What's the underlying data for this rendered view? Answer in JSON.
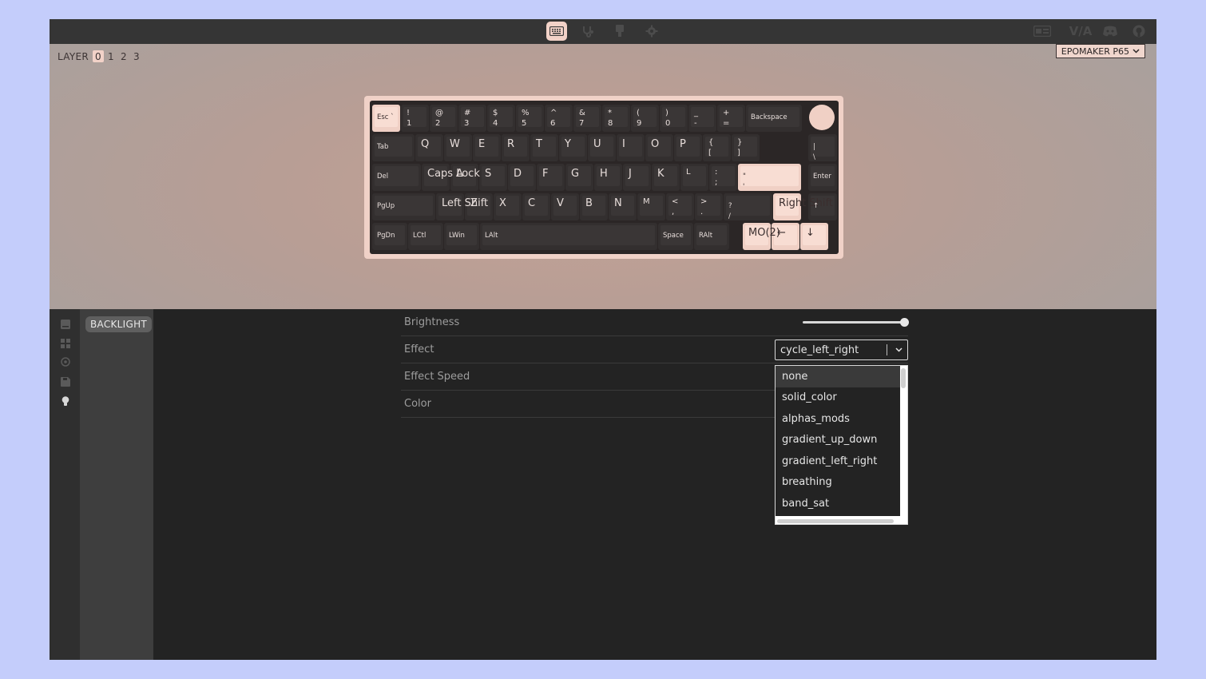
{
  "nav": {
    "items": [
      {
        "icon": "keyboard-icon",
        "active": true
      },
      {
        "icon": "stethoscope-icon",
        "active": false
      },
      {
        "icon": "brush-icon",
        "active": false
      },
      {
        "icon": "gear-icon",
        "active": false
      }
    ],
    "right_icons": [
      "keyboard-image-icon",
      "via-logo",
      "discord-icon",
      "github-icon"
    ],
    "via_logo_text": "V/A"
  },
  "layer": {
    "label": "LAYER",
    "numbers": [
      "0",
      "1",
      "2",
      "3"
    ],
    "active_index": 0
  },
  "keyboard_select": {
    "value": "EPOMAKER P65"
  },
  "keys": [
    {
      "label": "Esc `"
    },
    {
      "label": "!\n1"
    },
    {
      "label": "@\n2"
    },
    {
      "label": "#\n3"
    },
    {
      "label": "$\n4"
    },
    {
      "label": "%\n5"
    },
    {
      "label": "^\n6"
    },
    {
      "label": "&\n7"
    },
    {
      "label": "*\n8"
    },
    {
      "label": "(\n9"
    },
    {
      "label": ")\n0"
    },
    {
      "label": "_\n-"
    },
    {
      "label": "+\n="
    },
    {
      "label": "Backspace"
    },
    {
      "label": "Tab"
    },
    {
      "label": "Q"
    },
    {
      "label": "W"
    },
    {
      "label": "E"
    },
    {
      "label": "R"
    },
    {
      "label": "T"
    },
    {
      "label": "Y"
    },
    {
      "label": "U"
    },
    {
      "label": "I"
    },
    {
      "label": "O"
    },
    {
      "label": "P"
    },
    {
      "label": "{\n["
    },
    {
      "label": "}\n]"
    },
    {
      "label": "|\n\\"
    },
    {
      "label": "Del"
    },
    {
      "label": "Caps Lock"
    },
    {
      "label": "A"
    },
    {
      "label": "S"
    },
    {
      "label": "D"
    },
    {
      "label": "F"
    },
    {
      "label": "G"
    },
    {
      "label": "H"
    },
    {
      "label": "J"
    },
    {
      "label": "K"
    },
    {
      "label": "L"
    },
    {
      "label": ":\n;"
    },
    {
      "label": "\"\n'"
    },
    {
      "label": "Enter"
    },
    {
      "label": "PgUp"
    },
    {
      "label": "Left Shift"
    },
    {
      "label": "Z"
    },
    {
      "label": "X"
    },
    {
      "label": "C"
    },
    {
      "label": "V"
    },
    {
      "label": "B"
    },
    {
      "label": "N"
    },
    {
      "label": "M"
    },
    {
      "label": "<\n,"
    },
    {
      "label": ">\n."
    },
    {
      "label": "?\n/"
    },
    {
      "label": "Right Shift"
    },
    {
      "label": "↑"
    },
    {
      "label": "PgDn"
    },
    {
      "label": "LCtl"
    },
    {
      "label": "LWin"
    },
    {
      "label": "LAlt"
    },
    {
      "label": "Space"
    },
    {
      "label": "RAlt"
    },
    {
      "label": "MO(2)"
    },
    {
      "label": "←"
    },
    {
      "label": "↓"
    },
    {
      "label": "→"
    }
  ],
  "side_nav": {
    "icons": [
      "keymap-icon",
      "macros-icon",
      "layouts-icon",
      "save-load-icon",
      "lighting-bulb-icon"
    ]
  },
  "submenu": {
    "active_label": "BACKLIGHT"
  },
  "settings": {
    "brightness_label": "Brightness",
    "brightness_value": 1.0,
    "effect_label": "Effect",
    "effect_value": "cycle_left_right",
    "effect_speed_label": "Effect Speed",
    "color_label": "Color"
  },
  "dropdown": {
    "options": [
      "none",
      "solid_color",
      "alphas_mods",
      "gradient_up_down",
      "gradient_left_right",
      "breathing",
      "band_sat"
    ],
    "highlighted_index": 0
  },
  "colors": {
    "accent": "#f2d2c8",
    "key_dark": "#3a3636",
    "panel_dark": "#232323"
  }
}
